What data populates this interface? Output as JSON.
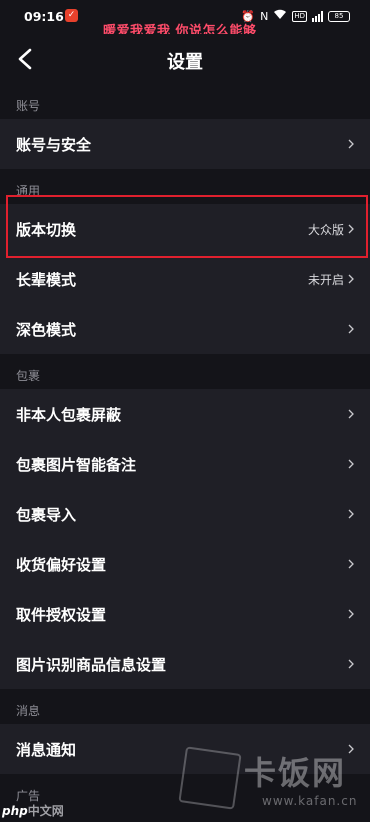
{
  "status_bar": {
    "time": "09:16",
    "marquee": "暖爱我爱我 你说怎么能够",
    "battery": "85"
  },
  "nav": {
    "title": "设置"
  },
  "sections": [
    {
      "header": "账号",
      "items": [
        {
          "label": "账号与安全",
          "value": ""
        }
      ]
    },
    {
      "header": "通用",
      "items": [
        {
          "label": "版本切换",
          "value": "大众版"
        },
        {
          "label": "长辈模式",
          "value": "未开启"
        },
        {
          "label": "深色模式",
          "value": ""
        }
      ]
    },
    {
      "header": "包裹",
      "items": [
        {
          "label": "非本人包裹屏蔽",
          "value": ""
        },
        {
          "label": "包裹图片智能备注",
          "value": ""
        },
        {
          "label": "包裹导入",
          "value": ""
        },
        {
          "label": "收货偏好设置",
          "value": ""
        },
        {
          "label": "取件授权设置",
          "value": ""
        },
        {
          "label": "图片识别商品信息设置",
          "value": ""
        }
      ]
    },
    {
      "header": "消息",
      "items": [
        {
          "label": "消息通知",
          "value": ""
        }
      ]
    },
    {
      "header": "广告",
      "items": []
    }
  ],
  "watermarks": {
    "kafan_cn": "卡饭网",
    "kafan_url": "www.kafan.cn",
    "php_prefix": "php",
    "php_suffix": "中文网"
  },
  "colors": {
    "background": "#141419",
    "row_background": "#1f1f26",
    "highlight_border": "#e0202e",
    "marquee_text": "#ff4c6a"
  }
}
